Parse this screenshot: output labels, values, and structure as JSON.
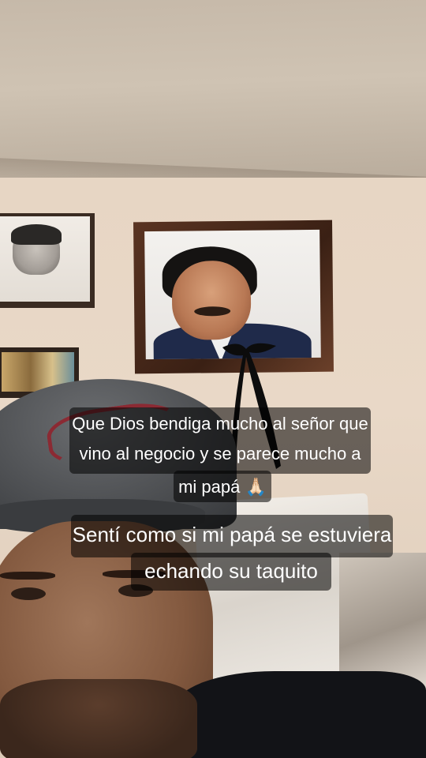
{
  "captions": {
    "first": {
      "line1": "Que Dios bendiga mucho al señor que",
      "line2": "vino al negocio y se parece mucho a",
      "line3": "mi papá 🙏🏻"
    },
    "second": {
      "line1": "Sentí como si mi papá se estuviera",
      "line2": "echando su taquito"
    }
  },
  "colors": {
    "caption_bg": "#000000",
    "caption_text": "#ffffff"
  }
}
